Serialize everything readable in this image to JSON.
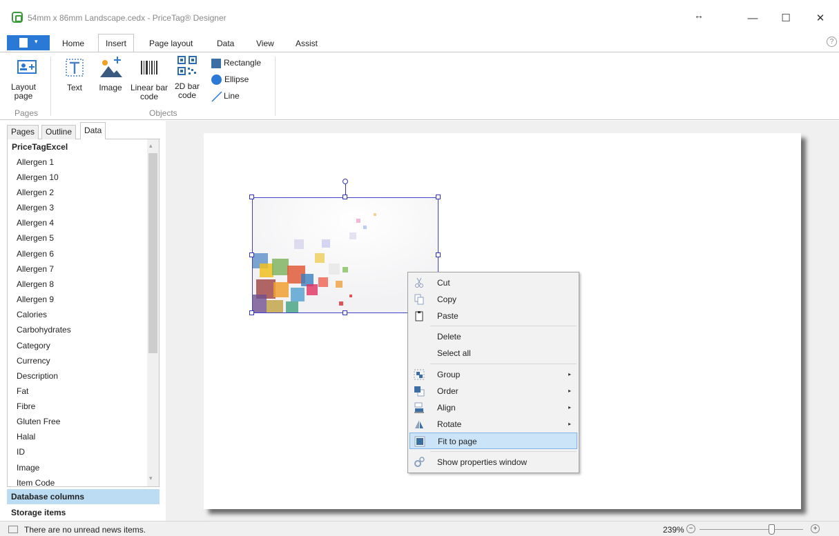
{
  "window": {
    "title": "54mm x 86mm Landscape.cedx - PriceTag® Designer",
    "resize_glyph": "↔",
    "minimize": "—",
    "maximize": "☐",
    "close": "✕"
  },
  "ribbon_tabs": {
    "file_caret": "▾",
    "tabs": [
      "Home",
      "Insert",
      "Page layout",
      "Data",
      "View",
      "Assist"
    ],
    "active": "Insert",
    "help": "?"
  },
  "ribbon": {
    "layout_page": "Layout page",
    "pages_group": "Pages",
    "text": "Text",
    "image": "Image",
    "linear_bar_code": "Linear bar code",
    "bar_code_2d": "2D bar code",
    "rectangle": "Rectangle",
    "ellipse": "Ellipse",
    "line": "Line",
    "objects_group": "Objects"
  },
  "left_panel": {
    "tabs": [
      "Pages",
      "Outline",
      "Data"
    ],
    "active_tab": "Data",
    "list_header": "PriceTagExcel",
    "items": [
      "Allergen 1",
      "Allergen 10",
      "Allergen 2",
      "Allergen 3",
      "Allergen 4",
      "Allergen 5",
      "Allergen 6",
      "Allergen 7",
      "Allergen 8",
      "Allergen 9",
      "Calories",
      "Carbohydrates",
      "Category",
      "Currency",
      "Description",
      "Fat",
      "Fibre",
      "Gluten Free",
      "Halal",
      "ID",
      "Image",
      "Item Code"
    ],
    "database_columns": "Database columns",
    "storage_items": "Storage items",
    "scroll_up": "▴",
    "scroll_down": "▾"
  },
  "context_menu": {
    "cut": "Cut",
    "copy": "Copy",
    "paste": "Paste",
    "delete": "Delete",
    "select_all": "Select all",
    "group": "Group",
    "order": "Order",
    "align": "Align",
    "rotate": "Rotate",
    "fit_to_page": "Fit to page",
    "show_properties": "Show properties window",
    "submenu_arrow": "▸"
  },
  "status_bar": {
    "news": "There are no unread news items.",
    "zoom": "239%",
    "zoom_level_fraction": 0.67,
    "zoom_minus": "−",
    "zoom_plus": "+"
  },
  "colors": {
    "accent": "#2b79d6",
    "selection": "#bcdcf4",
    "menu_highlight": "#cce4f7",
    "handle": "#3030c0"
  }
}
